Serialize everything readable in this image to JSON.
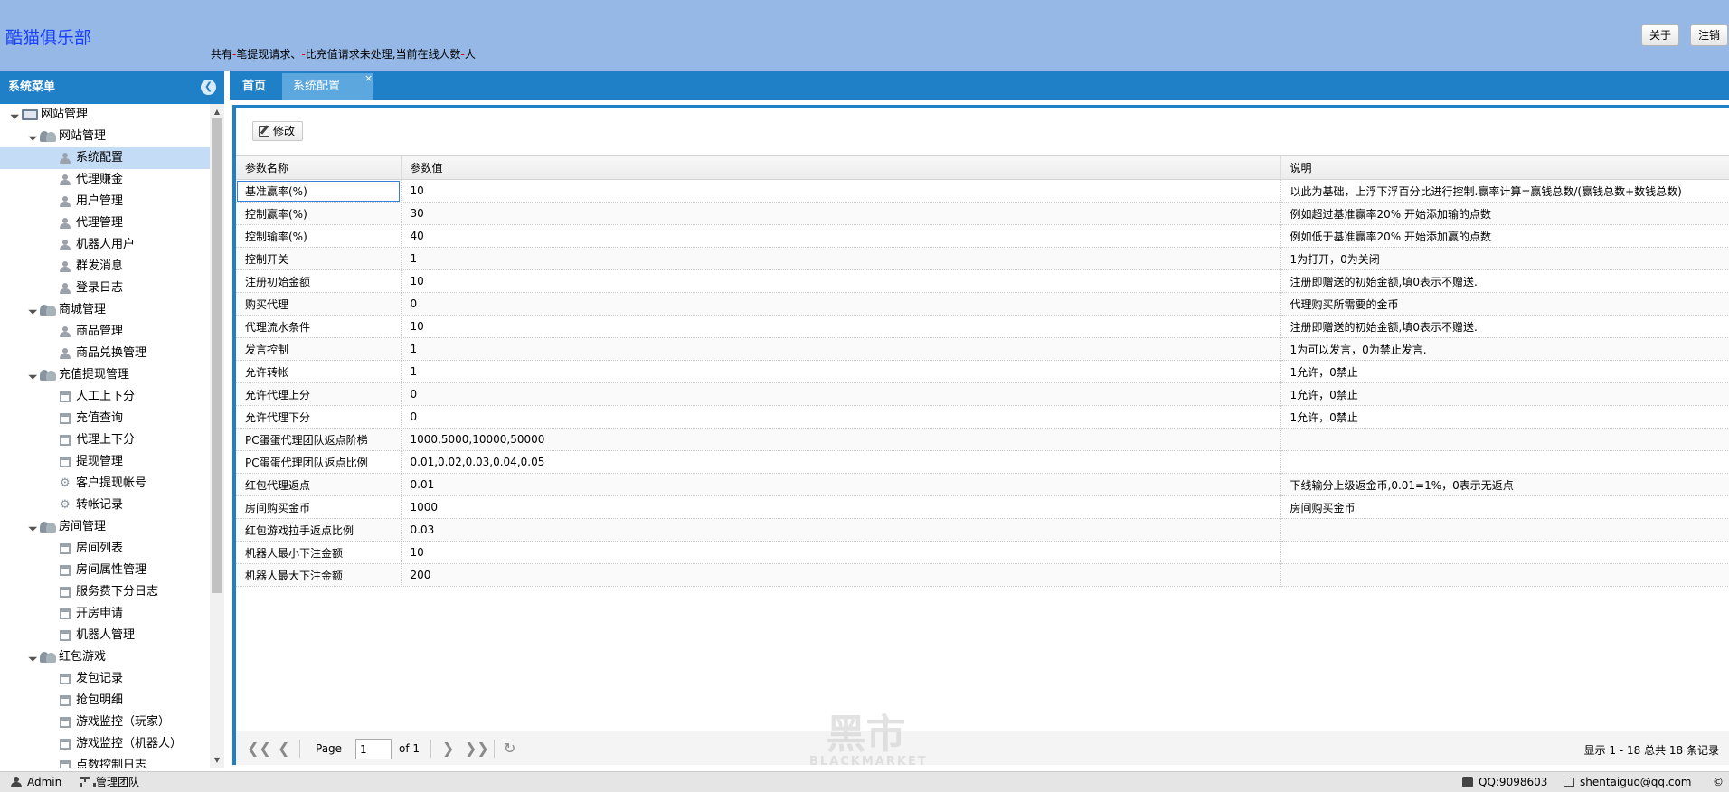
{
  "header": {
    "brand": "酷猫俱乐部",
    "notice_prefix": "共有",
    "notice_dash1": "-",
    "notice_mid": "笔提现请求、",
    "notice_dash2": "-",
    "notice_mid2": "比充值请求未处理,当前在线人数",
    "notice_dash3": "-",
    "notice_suffix": "人",
    "about_label": "关于",
    "logout_label": "注销"
  },
  "sidebar": {
    "title": "系统菜单",
    "toggle_icon": "collapse-left-icon",
    "tree": [
      {
        "label": "网站管理",
        "level": 0,
        "type": "root",
        "icon": "computer-icon"
      },
      {
        "label": "网站管理",
        "level": 1,
        "type": "group",
        "icon": "group-icon"
      },
      {
        "label": "系统配置",
        "level": 2,
        "type": "leaf",
        "icon": "user-icon",
        "selected": true
      },
      {
        "label": "代理赚金",
        "level": 2,
        "type": "leaf",
        "icon": "user-icon"
      },
      {
        "label": "用户管理",
        "level": 2,
        "type": "leaf",
        "icon": "user-icon"
      },
      {
        "label": "代理管理",
        "level": 2,
        "type": "leaf",
        "icon": "user-icon"
      },
      {
        "label": "机器人用户",
        "level": 2,
        "type": "leaf",
        "icon": "user-icon"
      },
      {
        "label": "群发消息",
        "level": 2,
        "type": "leaf",
        "icon": "user-icon"
      },
      {
        "label": "登录日志",
        "level": 2,
        "type": "leaf",
        "icon": "user-icon"
      },
      {
        "label": "商城管理",
        "level": 1,
        "type": "group",
        "icon": "group-icon"
      },
      {
        "label": "商品管理",
        "level": 2,
        "type": "leaf",
        "icon": "user-icon"
      },
      {
        "label": "商品兑换管理",
        "level": 2,
        "type": "leaf",
        "icon": "user-icon"
      },
      {
        "label": "充值提现管理",
        "level": 1,
        "type": "group",
        "icon": "group-icon"
      },
      {
        "label": "人工上下分",
        "level": 2,
        "type": "leaf",
        "icon": "gift-icon"
      },
      {
        "label": "充值查询",
        "level": 2,
        "type": "leaf",
        "icon": "gift-icon"
      },
      {
        "label": "代理上下分",
        "level": 2,
        "type": "leaf",
        "icon": "gift-icon"
      },
      {
        "label": "提现管理",
        "level": 2,
        "type": "leaf",
        "icon": "gift-icon"
      },
      {
        "label": "客户提现帐号",
        "level": 2,
        "type": "leaf",
        "icon": "gear-icon"
      },
      {
        "label": "转帐记录",
        "level": 2,
        "type": "leaf",
        "icon": "gear-icon"
      },
      {
        "label": "房间管理",
        "level": 1,
        "type": "group",
        "icon": "group-icon"
      },
      {
        "label": "房间列表",
        "level": 2,
        "type": "leaf",
        "icon": "gift-icon"
      },
      {
        "label": "房间属性管理",
        "level": 2,
        "type": "leaf",
        "icon": "gift-icon"
      },
      {
        "label": "服务费下分日志",
        "level": 2,
        "type": "leaf",
        "icon": "gift-icon"
      },
      {
        "label": "开房申请",
        "level": 2,
        "type": "leaf",
        "icon": "gift-icon"
      },
      {
        "label": "机器人管理",
        "level": 2,
        "type": "leaf",
        "icon": "gift-icon"
      },
      {
        "label": "红包游戏",
        "level": 1,
        "type": "group",
        "icon": "group-icon"
      },
      {
        "label": "发包记录",
        "level": 2,
        "type": "leaf",
        "icon": "gift-icon"
      },
      {
        "label": "抢包明细",
        "level": 2,
        "type": "leaf",
        "icon": "gift-icon"
      },
      {
        "label": "游戏监控（玩家）",
        "level": 2,
        "type": "leaf",
        "icon": "gift-icon"
      },
      {
        "label": "游戏监控（机器人）",
        "level": 2,
        "type": "leaf",
        "icon": "gift-icon"
      },
      {
        "label": "点数控制日志",
        "level": 2,
        "type": "leaf",
        "icon": "gift-icon"
      }
    ]
  },
  "tabs": {
    "home_label": "首页",
    "active_label": "系统配置",
    "close_glyph": "×"
  },
  "toolbar": {
    "edit_label": "修改"
  },
  "grid": {
    "columns": [
      "参数名称",
      "参数值",
      "说明"
    ],
    "rows": [
      [
        "基准赢率(%)",
        "10",
        "以此为基础，上浮下浮百分比进行控制.赢率计算=赢钱总数/(赢钱总数+数钱总数)"
      ],
      [
        "控制赢率(%)",
        "30",
        "例如超过基准赢率20% 开始添加输的点数"
      ],
      [
        "控制输率(%)",
        "40",
        "例如低于基准赢率20% 开始添加赢的点数"
      ],
      [
        "控制开关",
        "1",
        "1为打开，0为关闭"
      ],
      [
        "注册初始金额",
        "10",
        "注册即赠送的初始金额,填0表示不赠送."
      ],
      [
        "购买代理",
        "0",
        "代理购买所需要的金币"
      ],
      [
        "代理流水条件",
        "10",
        "注册即赠送的初始金额,填0表示不赠送."
      ],
      [
        "发言控制",
        "1",
        "1为可以发言，0为禁止发言."
      ],
      [
        "允许转帐",
        "1",
        "1允许，0禁止"
      ],
      [
        "允许代理上分",
        "0",
        "1允许，0禁止"
      ],
      [
        "允许代理下分",
        "0",
        "1允许，0禁止"
      ],
      [
        "PC蛋蛋代理团队返点阶梯",
        "1000,5000,10000,50000",
        ""
      ],
      [
        "PC蛋蛋代理团队返点比例",
        "0.01,0.02,0.03,0.04,0.05",
        ""
      ],
      [
        "红包代理返点",
        "0.01",
        "下线输分上级返金币,0.01=1%，0表示无返点"
      ],
      [
        "房间购买金币",
        "1000",
        "房间购买金币"
      ],
      [
        "红包游戏拉手返点比例",
        "0.03",
        ""
      ],
      [
        "机器人最小下注金额",
        "10",
        ""
      ],
      [
        "机器人最大下注金额",
        "200",
        ""
      ]
    ]
  },
  "pager": {
    "page_label": "Page",
    "page_value": "1",
    "of_label": "of 1",
    "info": "显示 1 - 18 总共 18 条记录"
  },
  "watermark": {
    "main": "黑市",
    "sub": "BLACKMARKET"
  },
  "footer": {
    "user": "Admin",
    "team": "管理团队",
    "qq": "QQ:9098603",
    "email": "shentaiguo@qq.com",
    "copyright": "©"
  }
}
